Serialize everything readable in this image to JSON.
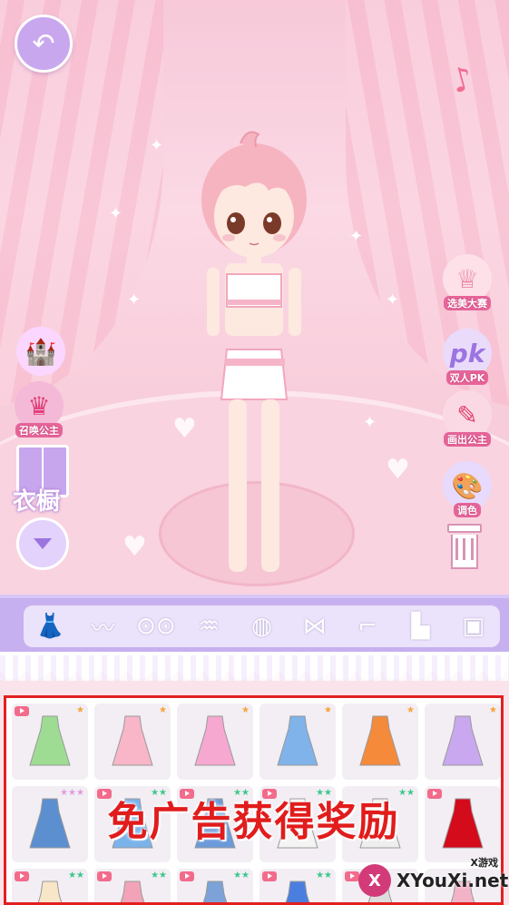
{
  "colors": {
    "accent_pink": "#ef5d8c",
    "lilac": "#c7b0ef",
    "promo_red": "#e11c1c",
    "frame_red": "#e22020"
  },
  "top": {
    "back_icon": "back-arrow-icon",
    "music_icon": "music-note-icon"
  },
  "left_menu": {
    "castle_icon": "castle-icon",
    "summon_label": "召唤公主",
    "wardrobe_label": "衣橱",
    "down_icon": "chevron-down-icon"
  },
  "right_menu": {
    "beauty_contest_label": "选美大赛",
    "pk_label": "双人PK",
    "pk_badge": "pk",
    "draw_princess_label": "画出公主",
    "color_label": "调色",
    "trash_icon": "trash-icon"
  },
  "categories": [
    {
      "name": "dress",
      "icon": "dress-icon",
      "glyph": "👗",
      "active": true
    },
    {
      "name": "wings",
      "icon": "wings-icon",
      "glyph": "〰"
    },
    {
      "name": "glasses",
      "icon": "glasses-icon",
      "glyph": "⊙⊙"
    },
    {
      "name": "hair",
      "icon": "hair-icon",
      "glyph": "♒"
    },
    {
      "name": "hat",
      "icon": "hat-icon",
      "glyph": "◍"
    },
    {
      "name": "bow",
      "icon": "bow-icon",
      "glyph": "⋈"
    },
    {
      "name": "shoes",
      "icon": "shoe-icon",
      "glyph": "⌐"
    },
    {
      "name": "socks",
      "icon": "sock-icon",
      "glyph": "▙"
    },
    {
      "name": "bag",
      "icon": "bag-icon",
      "glyph": "▣"
    }
  ],
  "items": [
    {
      "name": "green-onesie",
      "color": "#9edc93",
      "stars": "★",
      "star_color": "orange",
      "video": true
    },
    {
      "name": "pink-slip-dress",
      "color": "#f8b6c8",
      "stars": "★",
      "star_color": "orange",
      "video": false
    },
    {
      "name": "bunny-dress",
      "color": "#f7a8d0",
      "stars": "★",
      "star_color": "orange",
      "video": false
    },
    {
      "name": "blue-denim-dress",
      "color": "#7fb3ea",
      "stars": "★",
      "star_color": "orange",
      "video": false
    },
    {
      "name": "orange-dress",
      "color": "#f58a3a",
      "stars": "★",
      "star_color": "orange",
      "video": false
    },
    {
      "name": "lavender-lolita-dress",
      "color": "#c9a8f0",
      "stars": "★",
      "star_color": "orange",
      "video": false
    },
    {
      "name": "sailor-uniform",
      "color": "#5b8fd0",
      "stars": "★★★",
      "star_color": "pink",
      "video": false
    },
    {
      "name": "blue-qipao",
      "color": "#7ab2ea",
      "stars": "★★",
      "star_color": "green",
      "video": true
    },
    {
      "name": "blue-overall-dress",
      "color": "#6a9ad9",
      "stars": "★★",
      "star_color": "green",
      "video": true
    },
    {
      "name": "white-gown",
      "color": "#f4f4f4",
      "stars": "★★",
      "star_color": "green",
      "video": true
    },
    {
      "name": "white-cami",
      "color": "#eeeeee",
      "stars": "★★",
      "star_color": "green",
      "video": false
    },
    {
      "name": "red-gown",
      "color": "#d40b1a",
      "stars": "",
      "star_color": "green",
      "video": true
    },
    {
      "name": "cream-tutu",
      "color": "#f7e6c8",
      "stars": "★★",
      "star_color": "green",
      "video": true
    },
    {
      "name": "pink-frill-dress",
      "color": "#f2a3b8",
      "stars": "★★",
      "star_color": "green",
      "video": true
    },
    {
      "name": "plaid-blue-dress",
      "color": "#7ca2d8",
      "stars": "★★",
      "star_color": "green",
      "video": true
    },
    {
      "name": "sports-jersey",
      "color": "#4a7fe0",
      "stars": "★★",
      "star_color": "green",
      "video": true
    },
    {
      "name": "grey-dress",
      "color": "#dddddd",
      "stars": "",
      "star_color": "green",
      "video": true
    },
    {
      "name": "pink-frock",
      "color": "#f3b3c6",
      "stars": "",
      "star_color": "green",
      "video": false
    }
  ],
  "promo": {
    "text": "免广告获得奖励"
  },
  "watermark": {
    "small": "X游戏",
    "logo": "X",
    "site": "XYouXi.net"
  }
}
